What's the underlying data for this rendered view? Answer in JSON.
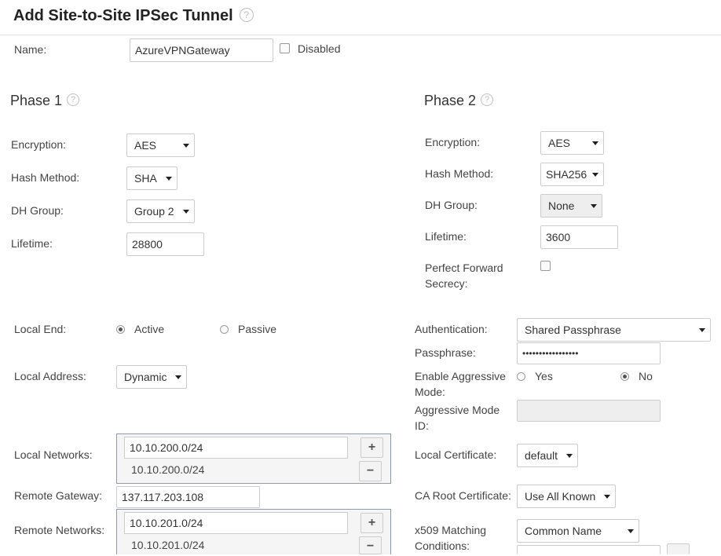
{
  "page": {
    "title": "Add Site-to-Site IPSec Tunnel",
    "help_glyph": "?"
  },
  "general": {
    "name_label": "Name:",
    "name_value": "AzureVPNGateway",
    "disabled_label": "Disabled",
    "disabled_checked": false
  },
  "phase1": {
    "title": "Phase 1",
    "encryption_label": "Encryption:",
    "encryption_value": "AES",
    "hash_label": "Hash Method:",
    "hash_value": "SHA",
    "dh_label": "DH Group:",
    "dh_value": "Group 2",
    "lifetime_label": "Lifetime:",
    "lifetime_value": "28800"
  },
  "phase2": {
    "title": "Phase 2",
    "encryption_label": "Encryption:",
    "encryption_value": "AES",
    "hash_label": "Hash Method:",
    "hash_value": "SHA256",
    "dh_label": "DH Group:",
    "dh_value": "None",
    "lifetime_label": "Lifetime:",
    "lifetime_value": "3600",
    "pfs_label_line1": "Perfect Forward",
    "pfs_label_line2": "Secrecy:",
    "pfs_checked": false
  },
  "local": {
    "end_label": "Local End:",
    "active_label": "Active",
    "passive_label": "Passive",
    "selected_end": "Active",
    "address_label": "Local Address:",
    "address_value": "Dynamic",
    "networks_label": "Local Networks:",
    "networks_input": "10.10.200.0/24",
    "networks_items": [
      "10.10.200.0/24"
    ]
  },
  "remote": {
    "gateway_label": "Remote Gateway:",
    "gateway_value": "137.117.203.108",
    "networks_label": "Remote Networks:",
    "networks_input": "10.10.201.0/24",
    "networks_items": [
      "10.10.201.0/24"
    ]
  },
  "auth": {
    "auth_label": "Authentication:",
    "auth_value": "Shared Passphrase",
    "pass_label": "Passphrase:",
    "pass_value": "•••••••••••••••••",
    "aggr_label_line1": "Enable Aggressive",
    "aggr_label_line2": "Mode:",
    "yes_label": "Yes",
    "no_label": "No",
    "aggr_selected": "No",
    "aggr_id_label_line1": "Aggressive Mode",
    "aggr_id_label_line2": "ID:",
    "aggr_id_value": "",
    "local_cert_label": "Local Certificate:",
    "local_cert_value": "default",
    "ca_label": "CA Root Certificate:",
    "ca_value": "Use All Known",
    "x509_label_line1": "x509 Matching",
    "x509_label_line2": "Conditions:",
    "x509_value": "Common Name"
  },
  "buttons": {
    "add": "+",
    "remove": "−"
  }
}
